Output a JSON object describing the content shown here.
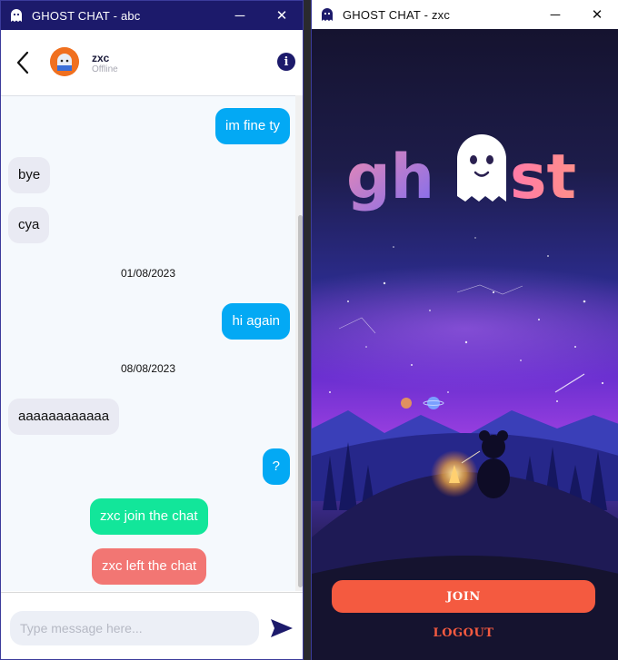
{
  "left_window": {
    "title": "GHOST CHAT - abc",
    "icon": "ghost-app-icon",
    "minimize": "─",
    "close": "✕",
    "header": {
      "back_icon": "chevron-left-icon",
      "contact_name": "zxc",
      "contact_status": "Offline",
      "info_icon": "info-icon",
      "info_glyph": "i"
    },
    "messages": {
      "m1": "im fine ty",
      "m2": "bye",
      "m3": "cya",
      "d1": "01/08/2023",
      "m4": "hi again",
      "d2": "08/08/2023",
      "m5": "aaaaaaaaaaaa",
      "m6": "?",
      "s1": "zxc join the chat",
      "s2": "zxc left the chat"
    },
    "composer": {
      "placeholder": "Type message here...",
      "send_icon": "send-icon"
    }
  },
  "right_window": {
    "title": "GHOST CHAT - zxc",
    "icon": "ghost-app-icon",
    "minimize": "─",
    "close": "✕",
    "logo": {
      "part1": "gh",
      "part2": "st"
    },
    "join_label": "JOIN",
    "logout_label": "LOGOUT"
  },
  "colors": {
    "titlebar_dark": "#1c1a6b",
    "outgoing_bubble": "#03a9f4",
    "incoming_bubble": "#e9eaf3",
    "join_system": "#12e69a",
    "left_system": "#f27673",
    "join_button": "#f45a40"
  }
}
